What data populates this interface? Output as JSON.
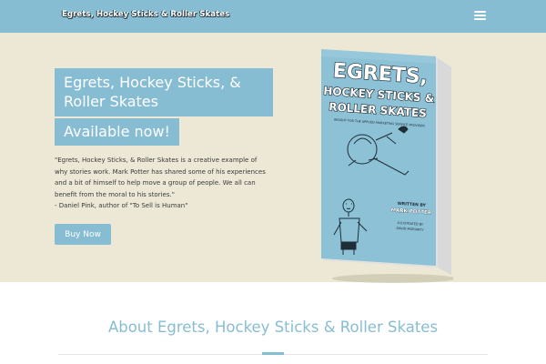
{
  "header": {
    "site_title": "Egrets, Hockey Sticks & Roller Skates",
    "menu_icon": "hamburger-menu-icon"
  },
  "hero": {
    "title": "Egrets, Hockey Sticks, & Roller Skates",
    "subtitle": "Available now!",
    "quote_lines": [
      "\"Egrets, Hockey Sticks, & Roller Skates is a creative example of",
      "why stories work.  Mark Potter has shared some of his experiences",
      "and a bit of himself to help move a group of people.  We all can",
      "benefit from the moral to his stories.\"",
      "- Daniel Pink, author of \"To Sell is Human\""
    ],
    "buy_button": "Buy Now"
  },
  "book_cover": {
    "title_lines": [
      "EGRETS,",
      "HOCKEY STICKS &",
      "ROLLER SKATES"
    ],
    "tagline": "INSIGHT FOR THE APPLIED MARKETING SERVICE PROVIDER",
    "written_by": "WRITTEN BY",
    "author": "MARK POTTER",
    "illustrated_by": "ILLUSTRATED BY",
    "illustrator": "DAVID MORIARTY",
    "colors": {
      "cover": "#8cc1d6",
      "pages": "#efefef"
    }
  },
  "about": {
    "title": "About Egrets, Hockey Sticks & Roller Skates"
  },
  "colors": {
    "accent": "#87bdd3",
    "hero_bg": "#ece8d5",
    "text": "#3a3a3a"
  }
}
